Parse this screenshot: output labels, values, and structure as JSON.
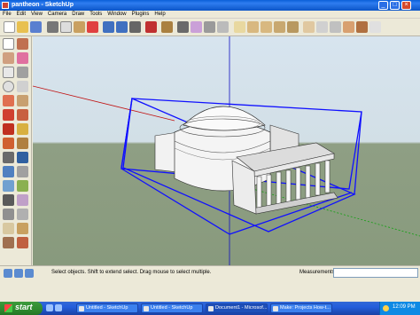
{
  "window": {
    "title": "pantheon - SketchUp",
    "minimize": "_",
    "maximize": "□",
    "close": "×"
  },
  "menu": [
    "File",
    "Edit",
    "View",
    "Camera",
    "Draw",
    "Tools",
    "Window",
    "Plugins",
    "Help"
  ],
  "status": {
    "hint": "Select objects. Shift to extend select. Drag mouse to select multiple.",
    "measurements_label": "Measurements",
    "measurements_value": ""
  },
  "taskbar": {
    "start_label": "start",
    "tasks": [
      {
        "label": "Untitled - SketchUp",
        "icon": "sketchup-icon"
      },
      {
        "label": "Untitled - SketchUp",
        "icon": "sketchup-icon"
      },
      {
        "label": "Document1 - Microsof...",
        "icon": "word-icon"
      },
      {
        "label": "Make: Projects How-t...",
        "icon": "browser-icon"
      }
    ],
    "clock": "12:09 PM"
  },
  "colors": {
    "selection_box": "#1010ff",
    "axis_red": "#c01010",
    "axis_green": "#10a010",
    "axis_blue": "#1010c0",
    "ground": "#8b9c7f",
    "sky": "#d5e2ec"
  }
}
